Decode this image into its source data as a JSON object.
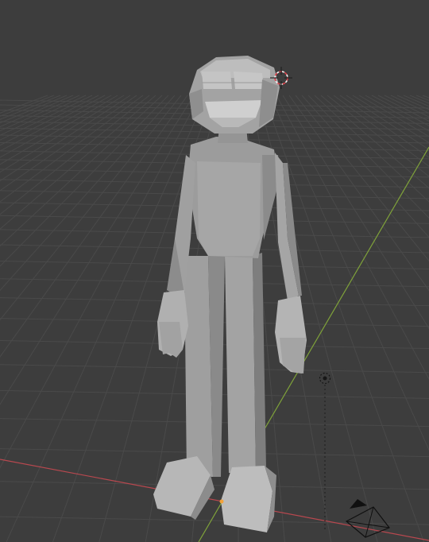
{
  "viewport": {
    "mode": "3d-viewport",
    "shading": "solid",
    "background_color": "#3d3d3d",
    "grid_color": "#4a4a4a",
    "x_axis_color": "#b8484f",
    "y_axis_color": "#7fa23a"
  },
  "scene": {
    "objects": [
      {
        "name": "character-mesh",
        "kind": "low-poly-humanoid",
        "color": "#9a9a9a"
      },
      {
        "name": "3d-cursor",
        "kind": "cursor",
        "color": "#e0404a"
      },
      {
        "name": "light",
        "kind": "point-light"
      },
      {
        "name": "camera",
        "kind": "camera"
      }
    ]
  }
}
